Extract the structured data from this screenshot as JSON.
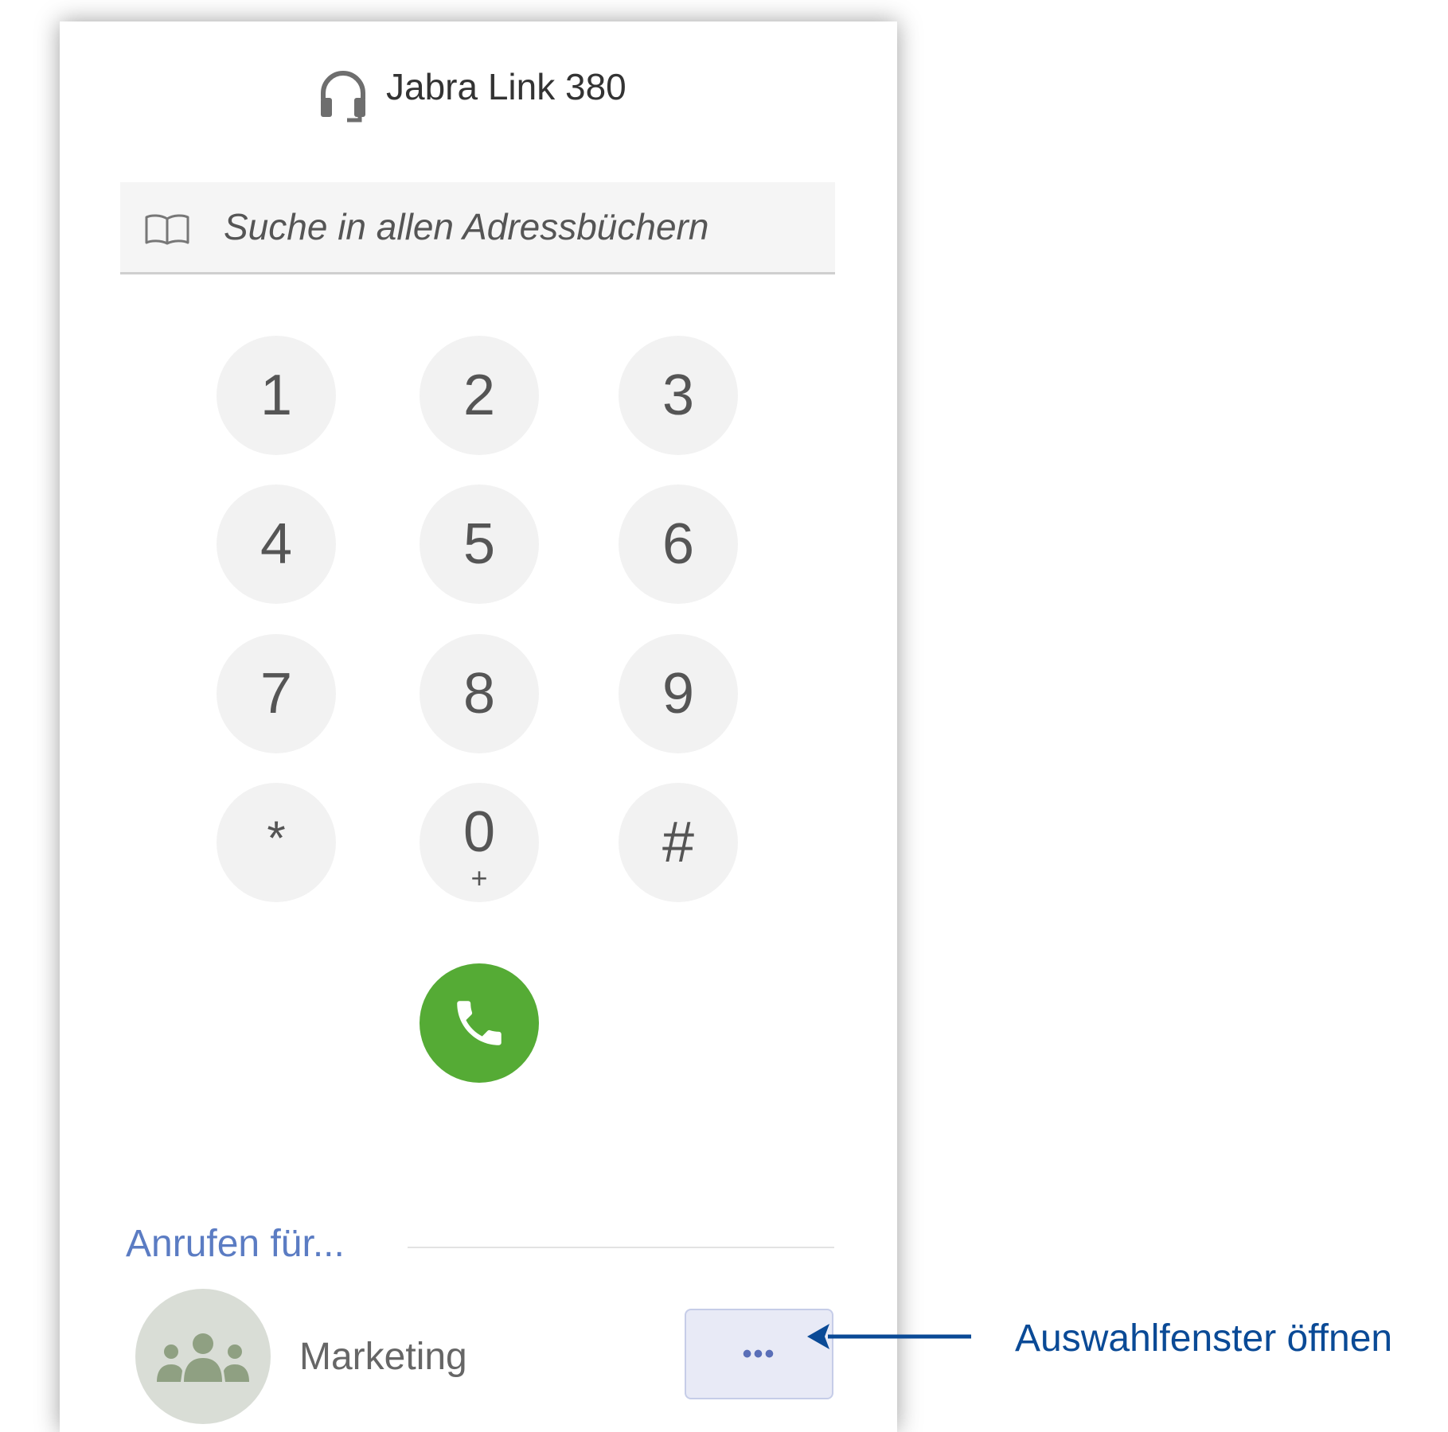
{
  "device": {
    "icon": "headset-icon",
    "label": "Jabra Link 380"
  },
  "search": {
    "icon": "book-icon",
    "placeholder": "Suche in allen Adressbüchern"
  },
  "dialpad": {
    "keys": [
      {
        "digit": "1",
        "sub": ""
      },
      {
        "digit": "2",
        "sub": ""
      },
      {
        "digit": "3",
        "sub": ""
      },
      {
        "digit": "4",
        "sub": ""
      },
      {
        "digit": "5",
        "sub": ""
      },
      {
        "digit": "6",
        "sub": ""
      },
      {
        "digit": "7",
        "sub": ""
      },
      {
        "digit": "8",
        "sub": ""
      },
      {
        "digit": "9",
        "sub": ""
      },
      {
        "digit": "*",
        "sub": ""
      },
      {
        "digit": "0",
        "sub": "+"
      },
      {
        "digit": "#",
        "sub": ""
      }
    ]
  },
  "call_button": {
    "icon": "phone-icon",
    "color": "#55ab35"
  },
  "call_for": {
    "title": "Anrufen für...",
    "contact": {
      "icon": "group-icon",
      "name": "Marketing",
      "more_label": "•••"
    }
  },
  "annotation": {
    "text": "Auswahlfenster öffnen",
    "color": "#0a4a96"
  }
}
